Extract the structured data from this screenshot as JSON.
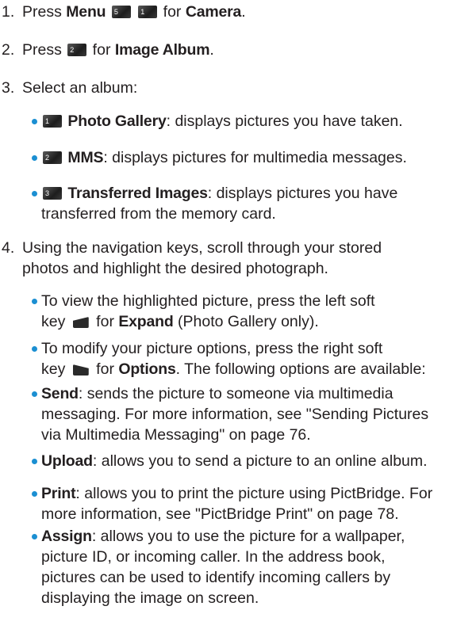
{
  "steps": [
    {
      "number": "1.",
      "pre": "Press ",
      "b1": "Menu",
      "keys": [
        "5",
        "1"
      ],
      "mid": " for ",
      "b2": "Camera",
      "post": "."
    },
    {
      "number": "2.",
      "pre": "Press ",
      "keys": [
        "2"
      ],
      "mid": " for ",
      "b1": "Image Album",
      "post": "."
    },
    {
      "number": "3.",
      "text": "Select an album:"
    },
    {
      "number": "4.",
      "line1": "Using the navigation keys, scroll through your stored",
      "line2": "photos and highlight the desired photograph."
    }
  ],
  "albums": [
    {
      "key": "1",
      "name": "Photo Gallery",
      "desc": ": displays pictures you have taken."
    },
    {
      "key": "2",
      "name": "MMS",
      "desc": ": displays pictures for multimedia messages."
    },
    {
      "key": "3",
      "name": "Transferred Images",
      "desc1": ": displays pictures you have",
      "desc2": "transferred from the memory card."
    }
  ],
  "view": {
    "l1": "To view the highlighted picture, press the left soft",
    "pre": "key ",
    "mid": " for ",
    "bold": "Expand",
    "post": " (Photo Gallery only)."
  },
  "modify": {
    "l1": "To modify your picture options, press the right soft",
    "pre": "key ",
    "mid": " for ",
    "bold": "Options",
    "post": ". The following options are available:"
  },
  "options": [
    {
      "name": "Send",
      "l1": ": sends the picture to someone via multimedia",
      "l2": "messaging. For more information, see \"Sending Pictures",
      "l3": "via Multimedia Messaging\" on page 76."
    },
    {
      "name": "Upload",
      "l1": ": allows you to send a picture to an online album."
    },
    {
      "name": "Print",
      "l1": ": allows you to print the picture using PictBridge. For",
      "l2": "more information, see \"PictBridge Print\" on page 78."
    },
    {
      "name": "Assign",
      "l1": ": allows you to use the picture for a wallpaper,",
      "l2": "picture ID, or incoming caller. In the address book,",
      "l3": "pictures can be used to identify incoming callers by",
      "l4": "displaying the image on screen."
    }
  ],
  "colors": {
    "text": "#231f20",
    "bullet": "#1b8fd2"
  }
}
